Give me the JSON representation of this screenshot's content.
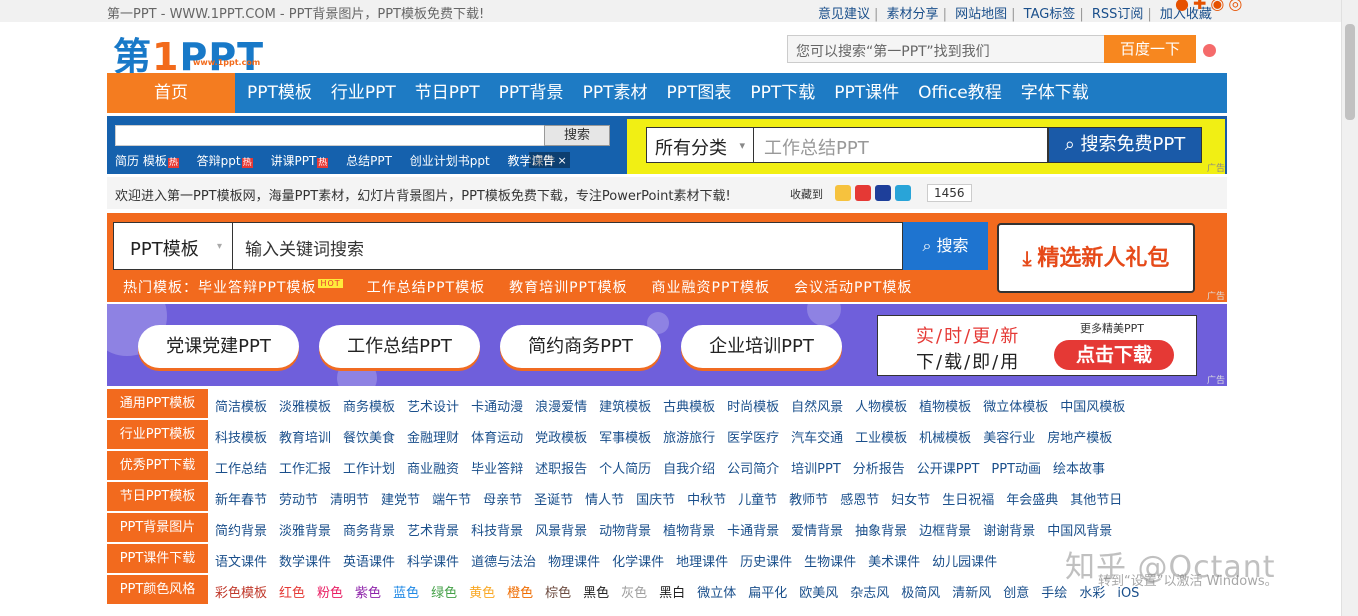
{
  "topbar": {
    "tagline": "第一PPT - WWW.1PPT.COM - PPT背景图片，PPT模板免费下载!",
    "links": [
      "意见建议",
      "素材分享",
      "网站地图",
      "TAG标签",
      "RSS订阅",
      "加入收藏"
    ]
  },
  "logo": {
    "main_a": "第",
    "main_one": "1",
    "main_b": "PPT",
    "sub": "www.1ppt.com"
  },
  "header_search": {
    "placeholder": "您可以搜索“第一PPT”找到我们",
    "button": "百度一下"
  },
  "nav": {
    "home": "首页",
    "items": [
      "PPT模板",
      "行业PPT",
      "节日PPT",
      "PPT背景",
      "PPT素材",
      "PPT图表",
      "PPT下载",
      "PPT课件",
      "Office教程",
      "字体下载"
    ]
  },
  "band1": {
    "button": "搜索",
    "tags": [
      "简历 模板",
      "答辩ppt",
      "讲课PPT",
      "总结PPT",
      "创业计划书ppt",
      "教学课件"
    ],
    "ad_close": "广告 ×"
  },
  "band2": {
    "category": "所有分类",
    "placeholder": "工作总结PPT",
    "button": "搜索免费PPT",
    "ad_tag": "广告"
  },
  "welcome": {
    "text": "欢迎进入第一PPT模板网，海量PPT素材，幻灯片背景图片，PPT模板免费下载，专注PowerPoint素材下载!",
    "fav_label": "收藏到",
    "count": "1456"
  },
  "promo": {
    "select": "PPT模板",
    "placeholder": "输入关键词搜索",
    "button": "搜索",
    "gift": "精选新人礼包",
    "hot_prefix": "热门模板：",
    "hot_items": [
      "毕业答辩PPT模板",
      "工作总结PPT模板",
      "教育培训PPT模板",
      "商业融资PPT模板",
      "会议活动PPT模板"
    ],
    "hot_badge": "HOT",
    "ad_tag": "广告"
  },
  "categories": {
    "pills": [
      "党课党建PPT",
      "工作总结PPT",
      "简约商务PPT",
      "企业培训PPT"
    ],
    "more_top": "实/时/更/新",
    "more_bottom": "下/载/即/用",
    "more_small": "更多精美PPT",
    "more_button": "点击下载",
    "ad_tag": "广告"
  },
  "grid": [
    {
      "label": "通用PPT模板",
      "items": [
        "简洁模板",
        "淡雅模板",
        "商务模板",
        "艺术设计",
        "卡通动漫",
        "浪漫爱情",
        "建筑模板",
        "古典模板",
        "时尚模板",
        "自然风景",
        "人物模板",
        "植物模板",
        "微立体模板",
        "中国风模板"
      ]
    },
    {
      "label": "行业PPT模板",
      "items": [
        "科技模板",
        "教育培训",
        "餐饮美食",
        "金融理财",
        "体育运动",
        "党政模板",
        "军事模板",
        "旅游旅行",
        "医学医疗",
        "汽车交通",
        "工业模板",
        "机械模板",
        "美容行业",
        "房地产模板"
      ]
    },
    {
      "label": "优秀PPT下载",
      "items": [
        "工作总结",
        "工作汇报",
        "工作计划",
        "商业融资",
        "毕业答辩",
        "述职报告",
        "个人简历",
        "自我介绍",
        "公司简介",
        "培训PPT",
        "分析报告",
        "公开课PPT",
        "PPT动画",
        "绘本故事"
      ]
    },
    {
      "label": "节日PPT模板",
      "items": [
        "新年春节",
        "劳动节",
        "清明节",
        "建党节",
        "端午节",
        "母亲节",
        "圣诞节",
        "情人节",
        "国庆节",
        "中秋节",
        "儿童节",
        "教师节",
        "感恩节",
        "妇女节",
        "生日祝福",
        "年会盛典",
        "其他节日"
      ]
    },
    {
      "label": "PPT背景图片",
      "items": [
        "简约背景",
        "淡雅背景",
        "商务背景",
        "艺术背景",
        "科技背景",
        "风景背景",
        "动物背景",
        "植物背景",
        "卡通背景",
        "爱情背景",
        "抽象背景",
        "边框背景",
        "谢谢背景",
        "中国风背景"
      ]
    },
    {
      "label": "PPT课件下载",
      "items": [
        "语文课件",
        "数学课件",
        "英语课件",
        "科学课件",
        "道德与法治",
        "物理课件",
        "化学课件",
        "地理课件",
        "历史课件",
        "生物课件",
        "美术课件",
        "幼儿园课件"
      ]
    },
    {
      "label": "PPT颜色风格",
      "items": [
        "彩色模板",
        "红色",
        "粉色",
        "紫色",
        "蓝色",
        "绿色",
        "黄色",
        "橙色",
        "棕色",
        "黑色",
        "灰色",
        "黑白",
        "微立体",
        "扁平化",
        "欧美风",
        "杂志风",
        "极简风",
        "清新风",
        "创意",
        "手绘",
        "水彩",
        "iOS"
      ]
    }
  ],
  "color_item_colors": [
    "#c0392b",
    "#e53935",
    "#e91e63",
    "#8e24aa",
    "#1e88e5",
    "#43a047",
    "#f9a825",
    "#ef6c00",
    "#6d4c41",
    "#222222",
    "#9e9e9e",
    "#222222"
  ],
  "watermark": {
    "main": "知乎 @Octant",
    "sub": "转到“设置”以激活 Windows。"
  }
}
